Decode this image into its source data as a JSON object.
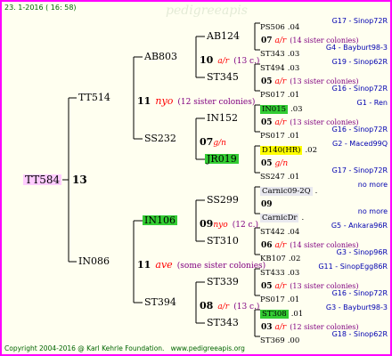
{
  "header": {
    "date": "23.  1-2016 ( 16: 58)"
  },
  "footer": {
    "copyright": "Copyright 2004-2016 @ Karl Kehrle Foundation.",
    "website": "www.pedigreeapis.org"
  },
  "root": {
    "name": "TT584",
    "grade": "13"
  },
  "gen1": [
    {
      "name": "TT514",
      "grade": "11",
      "race": "nyo",
      "note": "(12 sister colonies)"
    },
    {
      "name": "IN086",
      "grade": "11",
      "race": "ave",
      "note": "(some sister colonies)"
    }
  ],
  "gen2": [
    {
      "name": "AB803",
      "grade": "10",
      "race": "a/r",
      "note": "(13 c.)"
    },
    {
      "name": "SS232",
      "grade": "07",
      "race": "g/n",
      "note": ""
    },
    {
      "name": "IN106",
      "grade": "09",
      "race": "nyo",
      "note": "(12 c.)"
    },
    {
      "name": "ST394",
      "grade": "08",
      "race": "a/r",
      "note": "(13 c.)"
    }
  ],
  "gen3": [
    {
      "name": "AB124"
    },
    {
      "name": "ST345"
    },
    {
      "name": "IN152"
    },
    {
      "name": "JR019"
    },
    {
      "name": "SS299"
    },
    {
      "name": "ST310"
    },
    {
      "name": "ST339"
    },
    {
      "name": "ST343"
    }
  ],
  "gen4": [
    {
      "name": "PS506",
      "val": ".04",
      "code": "G17 - Sinop72R"
    },
    {
      "grade": "07",
      "race": "a/r",
      "note": "(14 sister colonies)"
    },
    {
      "name": "ST343",
      "val": ".03",
      "code": "G4 - Bayburt98-3"
    },
    {
      "name": "ST494",
      "val": ".03",
      "code": "G19 - Sinop62R"
    },
    {
      "grade": "05",
      "race": "a/r",
      "note": "(13 sister colonies)"
    },
    {
      "name": "PS017",
      "val": ".01",
      "code": "G16 - Sinop72R"
    },
    {
      "name": "IN015",
      "val": ".03",
      "code": "G1 - Ren"
    },
    {
      "grade": "05",
      "race": "a/r",
      "note": "(13 sister colonies)"
    },
    {
      "name": "PS017",
      "val": ".01",
      "code": "G16 - Sinop72R"
    },
    {
      "name": "D140(HR)",
      "val": ".02",
      "code": "G2 - Maced99Q"
    },
    {
      "grade": "05",
      "race": "g/n",
      "note": ""
    },
    {
      "name": "SS247",
      "val": ".01",
      "code": "G17 - Sinop72R"
    },
    {
      "name": "Carnic09-2Q",
      "val": ".",
      "code": "no more"
    },
    {
      "grade": "09",
      "race": "",
      "note": ""
    },
    {
      "name": "CarnicDr",
      "val": ".",
      "code": "no more"
    },
    {
      "name": "ST442",
      "val": ".04",
      "code": "G5 - Ankara96R"
    },
    {
      "grade": "06",
      "race": "a/r",
      "note": "(14 sister colonies)"
    },
    {
      "name": "KB107",
      "val": ".02",
      "code": "G3 - Sinop96R"
    },
    {
      "name": "ST433",
      "val": ".03",
      "code": "G11 - SinopEgg86R"
    },
    {
      "grade": "05",
      "race": "a/r",
      "note": "(13 sister colonies)"
    },
    {
      "name": "PS017",
      "val": ".01",
      "code": "G16 - Sinop72R"
    },
    {
      "name": "ST308",
      "val": ".01",
      "code": "G3 - Bayburt98-3"
    },
    {
      "grade": "03",
      "race": "a/r",
      "note": "(12 sister colonies)"
    },
    {
      "name": "ST369",
      "val": ".00",
      "code": "G18 - Sinop62R"
    }
  ]
}
